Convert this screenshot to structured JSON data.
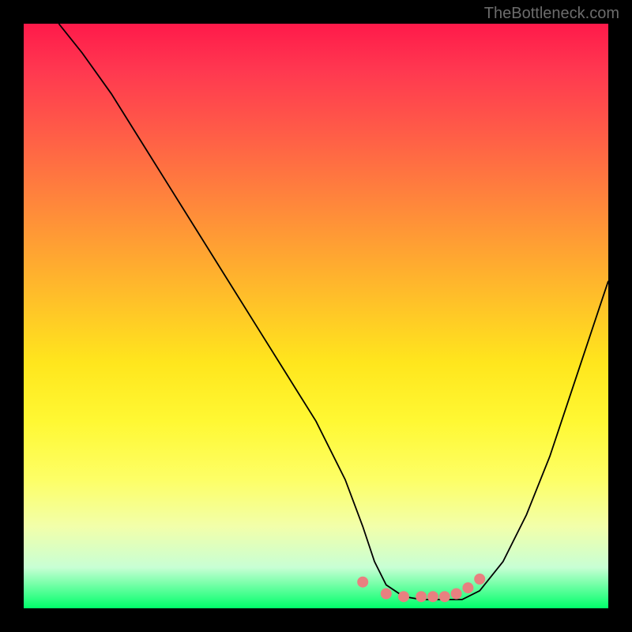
{
  "watermark": "TheBottleneck.com",
  "chart_data": {
    "type": "line",
    "title": "",
    "xlabel": "",
    "ylabel": "",
    "xlim": [
      0,
      100
    ],
    "ylim": [
      0,
      100
    ],
    "series": [
      {
        "name": "curve",
        "x": [
          6,
          10,
          15,
          20,
          25,
          30,
          35,
          40,
          45,
          50,
          55,
          58,
          60,
          62,
          65,
          68,
          70,
          72,
          75,
          78,
          82,
          86,
          90,
          94,
          98,
          100
        ],
        "y": [
          100,
          95,
          88,
          80,
          72,
          64,
          56,
          48,
          40,
          32,
          22,
          14,
          8,
          4,
          2,
          1.5,
          1.5,
          1.5,
          1.5,
          3,
          8,
          16,
          26,
          38,
          50,
          56
        ]
      }
    ],
    "bottom_markers": {
      "name": "highlight-dots",
      "color": "#e88080",
      "points": [
        {
          "x": 58,
          "y": 4.5
        },
        {
          "x": 62,
          "y": 2.5
        },
        {
          "x": 65,
          "y": 2
        },
        {
          "x": 68,
          "y": 2
        },
        {
          "x": 70,
          "y": 2
        },
        {
          "x": 72,
          "y": 2
        },
        {
          "x": 74,
          "y": 2.5
        },
        {
          "x": 76,
          "y": 3.5
        },
        {
          "x": 78,
          "y": 5
        }
      ]
    },
    "gradient_stops": [
      {
        "pos": 0,
        "color": "#ff1a4a"
      },
      {
        "pos": 0.5,
        "color": "#ffe61d"
      },
      {
        "pos": 0.92,
        "color": "#f2ffaa"
      },
      {
        "pos": 1,
        "color": "#00ff6a"
      }
    ]
  }
}
